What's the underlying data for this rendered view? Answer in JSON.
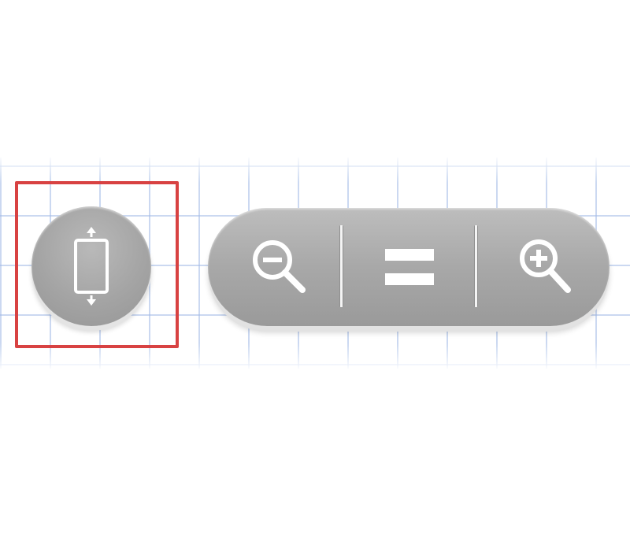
{
  "controls": {
    "rotate": {
      "icon": "rotate-device-icon"
    },
    "zoom_out": {
      "icon": "zoom-out-icon"
    },
    "actual_size": {
      "icon": "equals-icon"
    },
    "zoom_in": {
      "icon": "zoom-in-icon"
    }
  },
  "colors": {
    "highlight": "#d84242",
    "button_fill": "#a8a8a8",
    "icon": "#ffffff",
    "grid_line": "#a0b9e6"
  }
}
